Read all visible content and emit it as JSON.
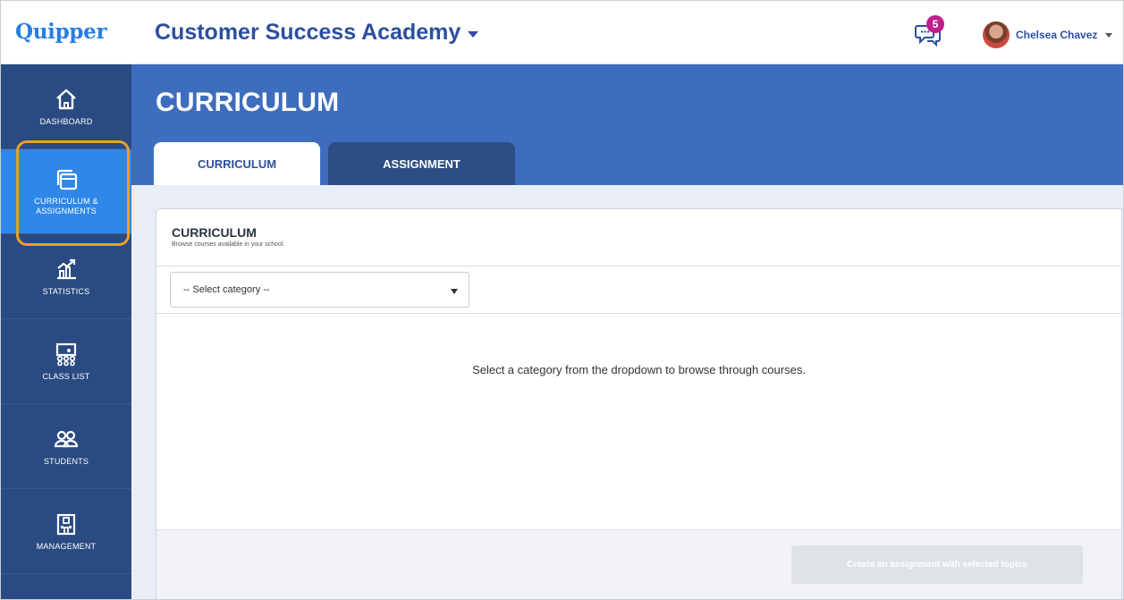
{
  "topbar": {
    "logo": "Quipper",
    "school_name": "Customer Success Academy",
    "notifications_count": "5",
    "user_name": "Chelsea Chavez"
  },
  "sidebar": {
    "items": [
      {
        "label": "DASHBOARD",
        "icon": "home-icon"
      },
      {
        "label": "CURRICULUM & ASSIGNMENTS",
        "icon": "curriculum-icon",
        "active": true
      },
      {
        "label": "STATISTICS",
        "icon": "statistics-icon"
      },
      {
        "label": "CLASS LIST",
        "icon": "class-list-icon"
      },
      {
        "label": "STUDENTS",
        "icon": "students-icon"
      },
      {
        "label": "MANAGEMENT",
        "icon": "management-icon"
      }
    ]
  },
  "page": {
    "title": "CURRICULUM",
    "tabs": [
      {
        "label": "CURRICULUM",
        "active": true
      },
      {
        "label": "ASSIGNMENT",
        "active": false
      }
    ]
  },
  "curriculum": {
    "title": "CURRICULUM",
    "subtitle": "Browse courses available in your school.",
    "category_select": "-- Select category --",
    "empty_message": "Select a category from the dropdown to browse through courses.",
    "create_button": "Create an assignment with selected topics"
  },
  "colors": {
    "brand_blue": "#2a7de1",
    "header_band": "#3f6dbe",
    "sidebar": "#2a4a82",
    "sidebar_active": "#2f87e8",
    "highlight": "#f0a020",
    "badge": "#c21e8b"
  }
}
